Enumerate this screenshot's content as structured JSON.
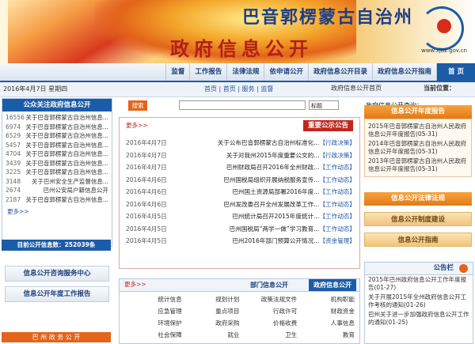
{
  "header": {
    "site_title": "巴音郭楞蒙古自治州",
    "site_subtitle": "政府信息公开",
    "url": "www.xjbz.gov.cn"
  },
  "nav": {
    "items": [
      "首 页",
      "政府信息公开指南",
      "政府信息公开目录",
      "依申请公开",
      "法律法规",
      "工作报告",
      "监督"
    ]
  },
  "crumb": {
    "label": "当前位置：",
    "home": "政府信息公开首页",
    "links": "首页 | 首页 | 服务 | 监督",
    "date": "2016年4月7日 星期四"
  },
  "left": {
    "title": "公众关注政府信息公开",
    "rows": [
      {
        "num": "16556",
        "text": "关于巴音郭楞蒙古自治州信息..."
      },
      {
        "num": "6974",
        "text": "关于巴音郭楞蒙古自治州信息..."
      },
      {
        "num": "6529",
        "text": "关于巴音郭楞蒙古自治州信息..."
      },
      {
        "num": "5457",
        "text": "关于巴音郭楞蒙古自治州信息..."
      },
      {
        "num": "4704",
        "text": "关于巴音郭楞蒙古自治州信息..."
      },
      {
        "num": "3439",
        "text": "关于巴音郭楞蒙古自治州信息..."
      },
      {
        "num": "3225",
        "text": "关于巴音郭楞蒙古自治州信息..."
      },
      {
        "num": "3148",
        "text": "关于巴州安全生产监督信息..."
      },
      {
        "num": "2674",
        "text": "巴州公安局户籍信息公开"
      },
      {
        "num": "2187",
        "text": "关于巴音郭楞蒙古自治州信息..."
      }
    ],
    "more": "更多>>",
    "stats": "目前公开信息数：252039条",
    "btn1": "信息公开咨询服务中心",
    "btn2": "信息公开年度工作报告",
    "banner": "巴 州 政 务 公 开"
  },
  "search": {
    "label": "政府信息公开查询：",
    "select": "标题",
    "button": "搜索"
  },
  "notice": {
    "title": "重要公示公告",
    "more": "更多>>",
    "rows": [
      {
        "tag": "【行政决策】",
        "text": "关于公布巴音郭楞蒙古自治州标准化...",
        "date": "2016年4月7日"
      },
      {
        "tag": "【行政决策】",
        "text": "关于对我州2015年度重要公文的...",
        "date": "2016年4月7日"
      },
      {
        "tag": "【工作动态】",
        "text": "巴州财政局召开2016年全州财政...",
        "date": "2016年4月7日"
      },
      {
        "tag": "【工作动态】",
        "text": "巴州国税局组织开展纳税服务宣传...",
        "date": "2016年4月6日"
      },
      {
        "tag": "【工作动态】",
        "text": "巴州国土资源局部署2016年度...",
        "date": "2016年4月6日"
      },
      {
        "tag": "【工作动态】",
        "text": "巴州发改委召开全州发展改革工作...",
        "date": "2016年4月6日"
      },
      {
        "tag": "【工作动态】",
        "text": "巴州统计局召开2015年度统计...",
        "date": "2016年4月5日"
      },
      {
        "tag": "【工作动态】",
        "text": "巴州国税局“两学一做”学习教育...",
        "date": "2016年4月5日"
      },
      {
        "tag": "【资金管理】",
        "text": "巴州2016年部门预算公开情况...",
        "date": "2016年4月5日"
      }
    ]
  },
  "gov": {
    "tab1": "政府信息公开",
    "tab2": "部门信息公开",
    "more": "更多>>",
    "cells": [
      "机构职能",
      "政策法规文件",
      "规划计划",
      "统计信息",
      "财政资金",
      "行政许可",
      "重点项目",
      "应急管理",
      "人事信息",
      "价格收费",
      "政府采购",
      "环境保护",
      "教育",
      "卫生",
      "就业",
      "社会保障"
    ]
  },
  "right": {
    "panel1_title": "信息公开年度报告",
    "panel1_rows": [
      "2015年巴音郭楞蒙古自治州人民政府信息公开年度报告(05-31)",
      "2014年巴音郭楞蒙古自治州人民政府信息公开年度报告(05-31)",
      "2013年巴音郭楞蒙古自治州人民政府信息公开年度报告(05-31)"
    ],
    "panel2_title": "信息公开法律法规",
    "btn1": "信息公开制度建设",
    "btn2": "信息公开指南",
    "gz_title": "公告栏",
    "gz_rows": [
      "2015年巴州政府信息公开工作年度报告(01-27)",
      "关于开展2015年全州政府信息公开工作考核的通知(01-26)",
      "巴州关于进一步加强政府信息公开工作的通知(01-25)"
    ]
  }
}
